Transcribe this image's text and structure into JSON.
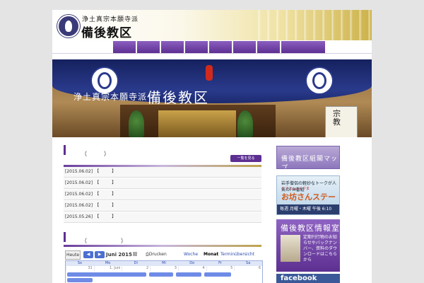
{
  "header": {
    "logo_sub": "浄土真宗本願寺派",
    "logo_main": "備後教区"
  },
  "nav": {
    "item_count": 8
  },
  "banner": {
    "sub": "浄土真宗本願寺派",
    "main": "備後教区",
    "sign": "宗教"
  },
  "news": {
    "heading": "（　　　）",
    "more_label": "一覧を見る",
    "items": [
      {
        "date": "[2015.06.02]",
        "text": "【　　　】"
      },
      {
        "date": "[2015.06.02]",
        "text": "【　　　】"
      },
      {
        "date": "[2015.06.02]",
        "text": "【　　　】"
      },
      {
        "date": "[2015.06.02]",
        "text": "【　　　】"
      },
      {
        "date": "[2015.05.26]",
        "text": "【　　　】"
      }
    ]
  },
  "calendar": {
    "heading": "（　　　　　　）",
    "today": "Heute",
    "prev": "◀",
    "next": "▶",
    "month": "Juni 2015",
    "print": "Drucken",
    "views": [
      "Woche",
      "Monat",
      "Terminübersicht"
    ],
    "days": [
      "So",
      "Mo",
      "Di",
      "Mi",
      "Do",
      "Fr",
      "Sa"
    ],
    "dates": [
      "31",
      "1. Juni",
      "2",
      "3",
      "4",
      "5",
      "6"
    ]
  },
  "sidebar": {
    "map": "備後教区組閣マップ",
    "radio_line1": "岩手僧侶の軽妙なトークが人気のFM番組",
    "radio_line2": "エフエムふくやま",
    "radio_title": "お坊さんステーション",
    "radio_time": "毎週 月曜・木曜 午後 6:10　FM 77.7MHz",
    "info_title": "備後教区情報室",
    "info_text": "定期刊行物のお知らせやバックナンバー、資料のダウンロードはこちらから",
    "facebook": "facebook"
  }
}
